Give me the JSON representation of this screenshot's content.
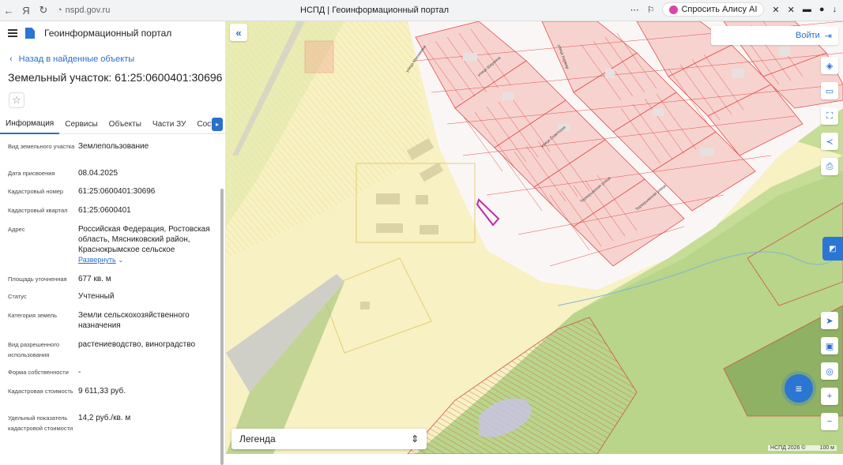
{
  "browser": {
    "url": "nspd.gov.ru",
    "tab_title": "НСПД | Геоинформационный портал",
    "alice_label": "Спросить Алису AI"
  },
  "app": {
    "title": "Геоинформационный портал",
    "back_label": "Назад в найденные объекты",
    "object_title": "Земельный участок: 61:25:0600401:30696"
  },
  "tabs": [
    {
      "label": "Информация"
    },
    {
      "label": "Сервисы"
    },
    {
      "label": "Объекты"
    },
    {
      "label": "Части ЗУ"
    },
    {
      "label": "Состав"
    }
  ],
  "attributes": [
    {
      "label": "Вид земельного участка",
      "value": "Землепользование"
    },
    {
      "label": "Дата присвоения",
      "value": "08.04.2025"
    },
    {
      "label": "Кадастровый номер",
      "value": "61:25:0600401:30696"
    },
    {
      "label": "Кадастровый квартал",
      "value": "61:25:0600401"
    },
    {
      "label": "Адрес",
      "value": "Российская Федерация, Ростовская область, Мясниковский район, Краснокрымское сельское",
      "link": "Развернуть"
    },
    {
      "label": "Площадь уточненная",
      "value": "677 кв. м"
    },
    {
      "label": "Статус",
      "value": "Учтенный"
    },
    {
      "label": "Категория земель",
      "value": "Земли сельскохозяйственного назначения"
    },
    {
      "label": "Вид разрешенного использования",
      "value": "растениеводство, виноградство"
    },
    {
      "label": "Форма собственности",
      "value": "-"
    },
    {
      "label": "Кадастровая стоимость",
      "value": "9 611,33 руб."
    },
    {
      "label": "Удельный показатель кадастровой стоимости",
      "value": "14,2 руб./кв. м"
    }
  ],
  "map": {
    "login_label": "Войти",
    "legend_label": "Легенда",
    "copyright": "НСПД 2026 ©",
    "scale": "100 м",
    "streets": [
      "улица Советская",
      "улица Мясникяна",
      "улица Шаумяна",
      "Терекрымская улица",
      "улица Кармир",
      "Терекрымская улица"
    ]
  },
  "colors": {
    "accent": "#2a6fc9",
    "parcel_stroke": "#e0504a",
    "selected_parcel": "#c02aa8",
    "agricultural": "#f5eaa0",
    "green_zone": "#bcd98c"
  }
}
